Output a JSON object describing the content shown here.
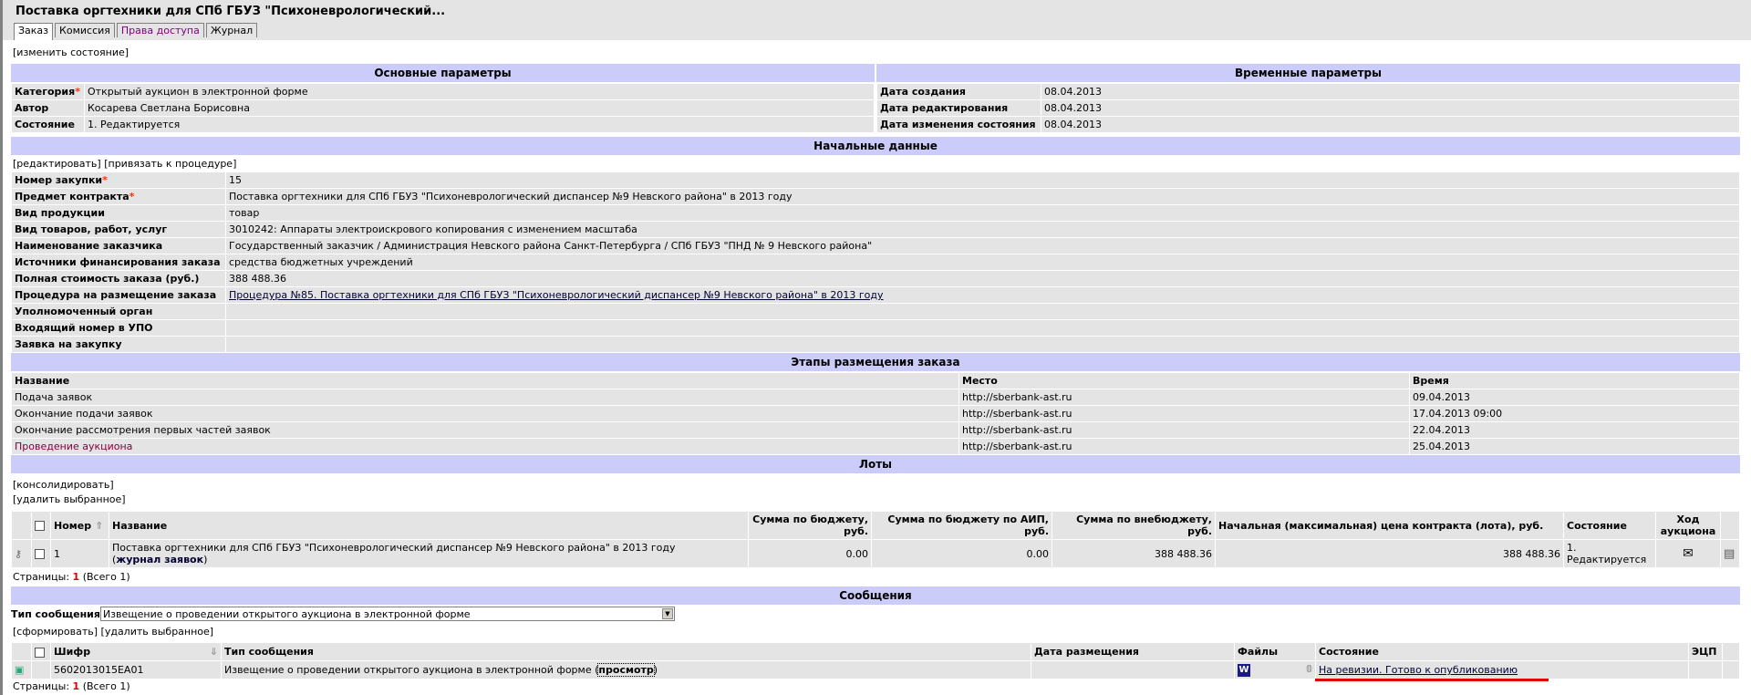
{
  "title": "Поставка оргтехники для СПб ГБУЗ \"Психоневрологический...",
  "tabs": [
    "Заказ",
    "Комиссия",
    "Права доступа",
    "Журнал"
  ],
  "change_state": "[изменить состояние]",
  "main_params": {
    "header": "Основные параметры",
    "rows": [
      {
        "label": "Категория",
        "required": "*",
        "value": "Открытый аукцион в электронной форме"
      },
      {
        "label": "Автор",
        "value": "Косарева Светлана Борисовна"
      },
      {
        "label": "Состояние",
        "value": "1. Редактируется"
      }
    ]
  },
  "time_params": {
    "header": "Временные параметры",
    "rows": [
      {
        "label": "Дата создания",
        "value": "08.04.2013"
      },
      {
        "label": "Дата редактирования",
        "value": "08.04.2013"
      },
      {
        "label": "Дата изменения состояния",
        "value": "08.04.2013"
      }
    ]
  },
  "initial": {
    "header": "Начальные данные",
    "edit": "[редактировать]",
    "bind": "[привязать к процедуре]",
    "rows": [
      {
        "label": "Номер закупки",
        "required": "*",
        "value": "15"
      },
      {
        "label": "Предмет контракта",
        "required": "*",
        "value": "Поставка оргтехники для СПб ГБУЗ \"Психоневрологический диспансер №9 Невского района\" в 2013 году"
      },
      {
        "label": "Вид продукции",
        "value": "товар"
      },
      {
        "label": "Вид товаров, работ, услуг",
        "value": "3010242: Аппараты электроискрового копирования с изменением масштаба"
      },
      {
        "label": "Наименование заказчика",
        "value": "Государственный заказчик / Администрация Невского района Санкт-Петербурга / СПб ГБУЗ \"ПНД № 9 Невского района\""
      },
      {
        "label": "Источники финансирования заказа",
        "value": "средства бюджетных учреждений"
      },
      {
        "label": "Полная стоимость заказа (руб.)",
        "value": "388 488.36"
      },
      {
        "label": "Процедура на размещение заказа",
        "value": "Процедура №85. Поставка оргтехники для СПб ГБУЗ \"Психоневрологический диспансер №9 Невского района\" в 2013 году",
        "link": true
      },
      {
        "label": "Уполномоченный орган",
        "value": ""
      },
      {
        "label": "Входящий номер в УПО",
        "value": ""
      },
      {
        "label": "Заявка на закупку",
        "value": ""
      }
    ]
  },
  "stages": {
    "header": "Этапы размещения заказа",
    "columns": [
      "Название",
      "Место",
      "Время"
    ],
    "rows": [
      [
        "Подача заявок",
        "http://sberbank-ast.ru",
        "09.04.2013"
      ],
      [
        "Окончание подачи заявок",
        "http://sberbank-ast.ru",
        "17.04.2013 09:00"
      ],
      [
        "Окончание рассмотрения первых частей заявок",
        "http://sberbank-ast.ru",
        "22.04.2013"
      ],
      [
        "Проведение аукциона",
        "http://sberbank-ast.ru",
        "25.04.2013"
      ]
    ]
  },
  "lots": {
    "header": "Лоты",
    "consolidate": "[консолидировать]",
    "delete": "[удалить выбранное]",
    "columns": [
      "Номер",
      "Название",
      "Сумма по бюджету, руб.",
      "Сумма по бюджету по АИП, руб.",
      "Сумма по внебюджету, руб.",
      "Начальная (максимальная) цена контракта (лота), руб.",
      "Состояние",
      "Ход аукциона"
    ],
    "row": {
      "number": "1",
      "name": "Поставка оргтехники для СПб ГБУЗ \"Психоневрологический диспансер №9 Невского района\" в 2013 году",
      "journal": "журнал заявок",
      "budget": "0.00",
      "aip": "0.00",
      "offbudget": "388 488.36",
      "price": "388 488.36",
      "state": "1. Редактируется"
    },
    "pages_label": "Страницы:",
    "page": "1",
    "total": "(Всего 1)"
  },
  "messages": {
    "header": "Сообщения",
    "type_label": "Тип сообщения",
    "type_value": "Извещение о проведении открытого аукциона в электронной форме",
    "form": "[сформировать]",
    "delete": "[удалить выбранное]",
    "columns": [
      "Шифр",
      "Тип сообщения",
      "Дата размещения",
      "Файлы",
      "Состояние",
      "ЭЦП"
    ],
    "row": {
      "code": "5602013015EA01",
      "type": "Извещение о проведении открытого аукциона в электронной форме",
      "view": "просмотр",
      "date": "",
      "state": "На ревизии. Готово к опубликованию"
    },
    "pages_label": "Страницы:",
    "page": "1",
    "total": "(Всего 1)"
  },
  "colors": {
    "band": "#ccccfa",
    "row": "#e4e4e4",
    "highlight": "#e00000"
  }
}
